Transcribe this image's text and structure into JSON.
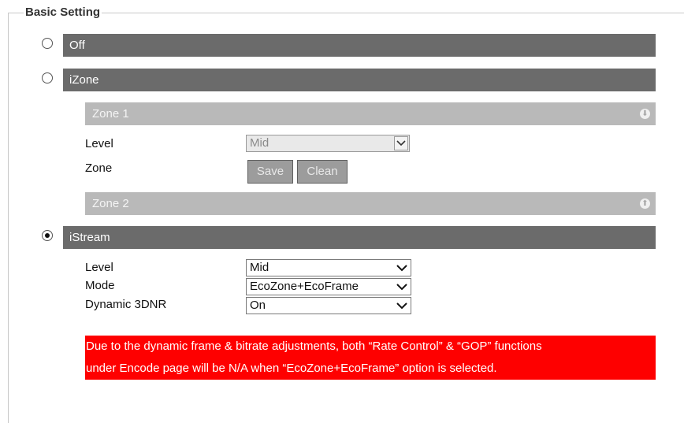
{
  "legend": "Basic Setting",
  "options": {
    "off": {
      "label": "Off",
      "selected": false
    },
    "izone": {
      "label": "iZone",
      "selected": false
    },
    "istream": {
      "label": "iStream",
      "selected": true
    }
  },
  "izone": {
    "zone1": {
      "title": "Zone 1"
    },
    "level_label": "Level",
    "level_value": "Mid",
    "zone_label": "Zone",
    "save_label": "Save",
    "clean_label": "Clean",
    "zone2": {
      "title": "Zone 2"
    }
  },
  "istream": {
    "level_label": "Level",
    "level_value": "Mid",
    "mode_label": "Mode",
    "mode_value": "EcoZone+EcoFrame",
    "dnr_label": "Dynamic 3DNR",
    "dnr_value": "On"
  },
  "notice": {
    "line1": "Due to the dynamic frame & bitrate adjustments, both “Rate Control” & “GOP” functions",
    "line2": "under Encode page will be N/A when “EcoZone+EcoFrame” option is selected."
  },
  "colors": {
    "section_bar": "#6b6b6b",
    "zone_bar": "#b9b9b9",
    "warning": "#fe0000"
  }
}
